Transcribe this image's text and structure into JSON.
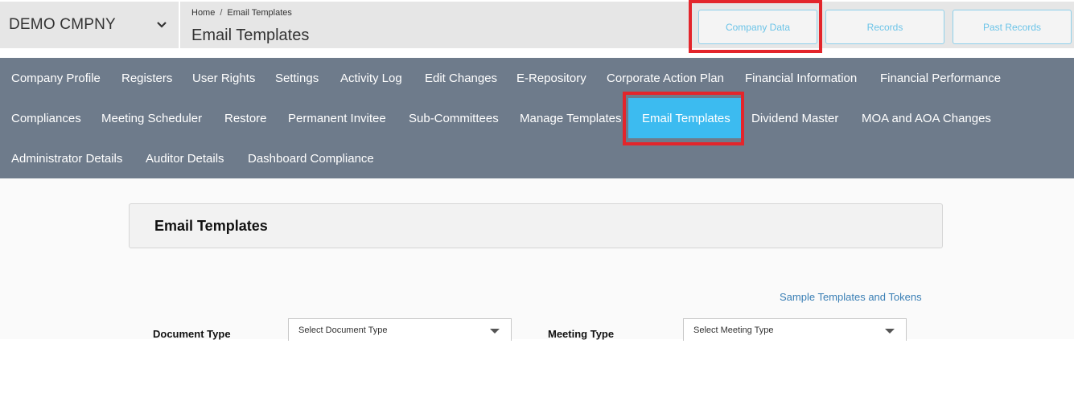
{
  "header": {
    "company": "DEMO CMPNY",
    "breadcrumb": [
      "Home",
      "/",
      "Email Templates"
    ],
    "title": "Email Templates",
    "buttons": [
      "Company Data",
      "Records",
      "Past Records"
    ]
  },
  "nav": {
    "row1": [
      "Company Profile",
      "Registers",
      "User Rights",
      "Settings",
      "Activity Log",
      "Edit Changes",
      "E-Repository",
      "Corporate Action Plan",
      "Financial Information",
      "Financial Performance"
    ],
    "row2": [
      "Compliances",
      "Meeting Scheduler",
      "Restore",
      "Permanent Invitee",
      "Sub-Committees",
      "Manage Templates",
      "Email Templates",
      "Dividend Master",
      "MOA and AOA Changes"
    ],
    "row3": [
      "Administrator Details",
      "Auditor Details",
      "Dashboard Compliance"
    ],
    "active": "Email Templates"
  },
  "main": {
    "panel_title": "Email Templates",
    "sample_link": "Sample Templates and Tokens",
    "document_type_label": "Document Type",
    "document_type_value": "Select Document Type",
    "meeting_type_label": "Meeting Type",
    "meeting_type_value": "Select Meeting Type"
  },
  "colors": {
    "nav_bg": "#6e7b8b",
    "active_tab": "#3cbbf0",
    "highlight": "#e3252b",
    "link": "#3a7fb5"
  },
  "icons": {
    "company_dropdown": "chevron-down-icon",
    "select_dropdown": "caret-down-icon"
  }
}
